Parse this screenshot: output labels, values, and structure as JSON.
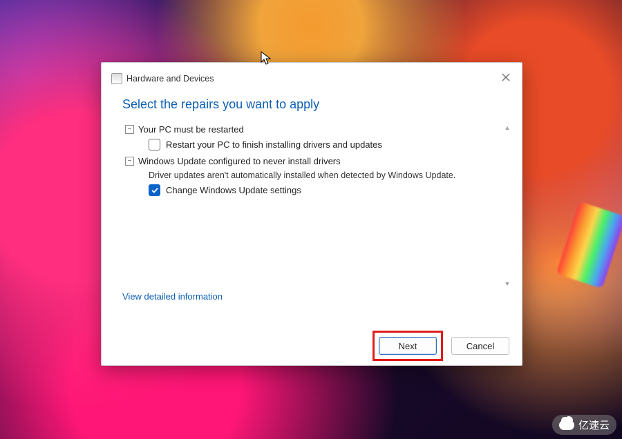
{
  "window": {
    "title": "Hardware and Devices"
  },
  "heading": "Select the repairs you want to apply",
  "groups": [
    {
      "title": "Your PC must be restarted",
      "description": "",
      "option": {
        "label": "Restart your PC to finish installing drivers and updates",
        "checked": false
      }
    },
    {
      "title": "Windows Update configured to never install drivers",
      "description": "Driver updates aren't automatically installed when detected by Windows Update.",
      "option": {
        "label": "Change Windows Update settings",
        "checked": true
      }
    }
  ],
  "link_detailed": "View detailed information",
  "buttons": {
    "next": "Next",
    "cancel": "Cancel"
  },
  "watermark": "亿速云"
}
